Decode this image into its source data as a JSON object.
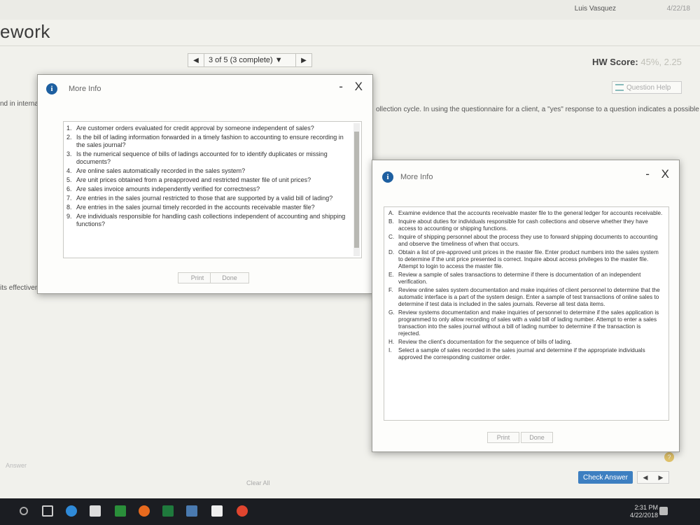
{
  "header": {
    "user": "Luis Vasquez",
    "date_partial": "4/22/18",
    "app_title_fragment": "ework"
  },
  "nav": {
    "prev": "◀",
    "position_label": "3 of 5 (3 complete) ▼",
    "next": "▶"
  },
  "hw_score": {
    "label": "HW Score:",
    "value": "45%, 2.25"
  },
  "question_help": "Question Help",
  "background_text": {
    "left_fragment": "nd in interna",
    "right_fragment": "ollection cycle. In using the questionnaire for a client, a \"yes\" response to a question indicates a possible",
    "left_fragment_2": "its effectiveness",
    "answer_fragment": "Answer",
    "clear_all": "Clear All",
    "check_answer": "Check Answer",
    "help_q": "?"
  },
  "dialog1": {
    "icon": "i",
    "title": "More Info",
    "controls": "- X",
    "items": [
      {
        "n": "1.",
        "text": "Are customer orders evaluated for credit approval by someone independent of sales?"
      },
      {
        "n": "2.",
        "text": "Is the bill of lading information forwarded in a timely fashion to accounting to ensure recording in the sales journal?"
      },
      {
        "n": "3.",
        "text": "Is the numerical sequence of bills of ladings accounted for to identify duplicates or missing documents?"
      },
      {
        "n": "4.",
        "text": "Are online sales automatically recorded in the sales system?"
      },
      {
        "n": "5.",
        "text": "Are unit prices obtained from a preapproved and restricted master file of unit prices?"
      },
      {
        "n": "6.",
        "text": "Are sales invoice amounts independently verified for correctness?"
      },
      {
        "n": "7.",
        "text": "Are entries in the sales journal restricted to those that are supported by a valid bill of lading?"
      },
      {
        "n": "8.",
        "text": "Are entries in the sales journal timely recorded in the accounts receivable master file?"
      },
      {
        "n": "9.",
        "text": "Are individuals responsible for handling cash collections independent of accounting and shipping functions?"
      }
    ],
    "print": "Print",
    "done": "Done"
  },
  "dialog2": {
    "icon": "i",
    "title": "More Info",
    "controls": "- X",
    "items": [
      {
        "n": "A.",
        "text": "Examine evidence that the accounts receivable master file to the general ledger for accounts receivable."
      },
      {
        "n": "B.",
        "text": "Inquire about duties for individuals responsible for cash collections and observe whether they have access to accounting or shipping functions."
      },
      {
        "n": "C.",
        "text": "Inquire of shipping personnel about the process they use to forward shipping documents to accounting and observe the timeliness of when that occurs."
      },
      {
        "n": "D.",
        "text": "Obtain a list of pre-approved unit prices in the master file. Enter product numbers into the sales system to determine if the unit price presented is correct. Inquire about access privileges to the master file. Attempt to login to access the master file."
      },
      {
        "n": "E.",
        "text": "Review a sample of sales transactions to determine if there is documentation of an independent verification."
      },
      {
        "n": "F.",
        "text": "Review online sales system documentation and make inquiries of client personnel to determine that the automatic interface is a part of the system design. Enter a sample of test transactions of online sales to determine if test data is included in the sales journals. Reverse all test data items."
      },
      {
        "n": "G.",
        "text": "Review systems documentation and make inquiries of personnel to determine if the sales application is programmed to only allow recording of sales with a valid bill of lading number. Attempt to enter a sales transaction into the sales journal without a bill of lading number to determine if the transaction is rejected."
      },
      {
        "n": "H.",
        "text": "Review the client's documentation for the sequence of bills of lading."
      },
      {
        "n": "I.",
        "text": "Select a sample of sales recorded in the sales journal and determine if the appropriate individuals approved the corresponding customer order."
      }
    ],
    "print": "Print",
    "done": "Done"
  },
  "taskbar": {
    "time": "2:31 PM",
    "date": "4/22/2018"
  }
}
